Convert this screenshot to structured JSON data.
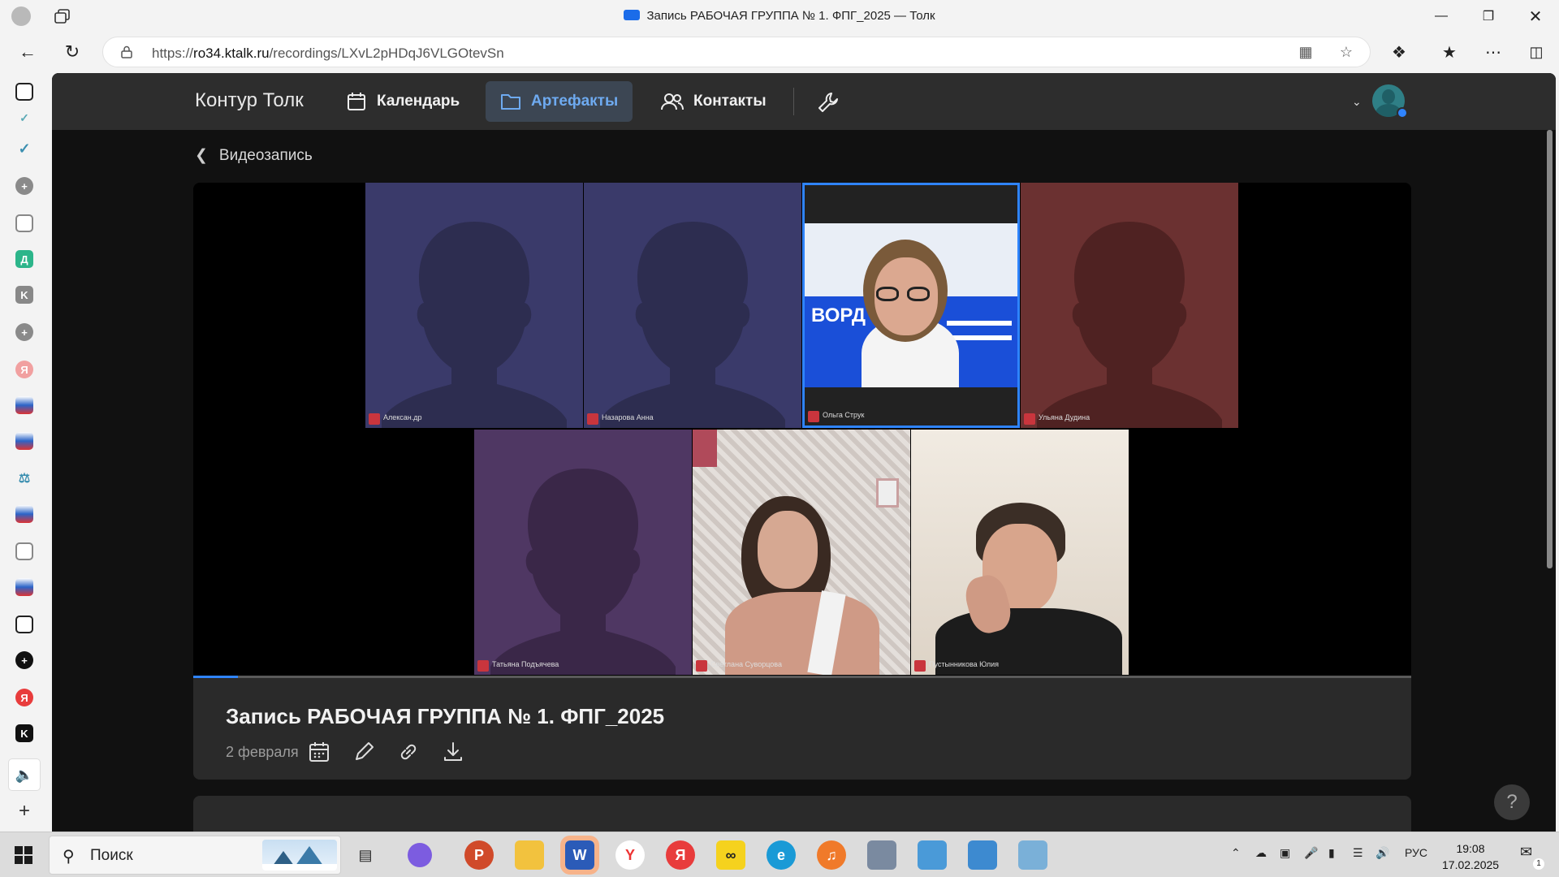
{
  "browser": {
    "window_title": "Запись РАБОЧАЯ ГРУППА № 1. ФПГ_2025 — Толк",
    "url_prefix": "https://",
    "url_host": "ro34.ktalk.ru",
    "url_path": "/recordings/LXvL2pHDqJ6VLGOtevSn"
  },
  "app": {
    "brand": "Контур Толк",
    "nav": [
      {
        "label": "Календарь",
        "active": false
      },
      {
        "label": "Артефакты",
        "active": true
      },
      {
        "label": "Контакты",
        "active": false
      }
    ],
    "back_label": "Видеозапись"
  },
  "participants": [
    {
      "name": "Алексан.др",
      "kind": "placeholder",
      "color": "#3a3a6a"
    },
    {
      "name": "Назарова Анна",
      "kind": "placeholder",
      "color": "#3a3a6a"
    },
    {
      "name": "Ольга Струк",
      "kind": "video",
      "speaking": true
    },
    {
      "name": "Ульяна Дудина",
      "kind": "placeholder",
      "color": "#6b3131"
    },
    {
      "name": "Татьяна Подъячева",
      "kind": "placeholder",
      "color": "#4f3763"
    },
    {
      "name": "Светлана Суворцова",
      "kind": "video"
    },
    {
      "name": "Пустынникова Юлия",
      "kind": "video"
    }
  ],
  "recording": {
    "title": "Запись РАБОЧАЯ ГРУППА № 1. ФПГ_2025",
    "date": "2 февраля",
    "progress": 0.037
  },
  "taskbar": {
    "search_label": "Поиск",
    "lang": "РУС",
    "time": "19:08",
    "date": "17.02.2025",
    "notif_count": "1"
  },
  "help_label": "?"
}
